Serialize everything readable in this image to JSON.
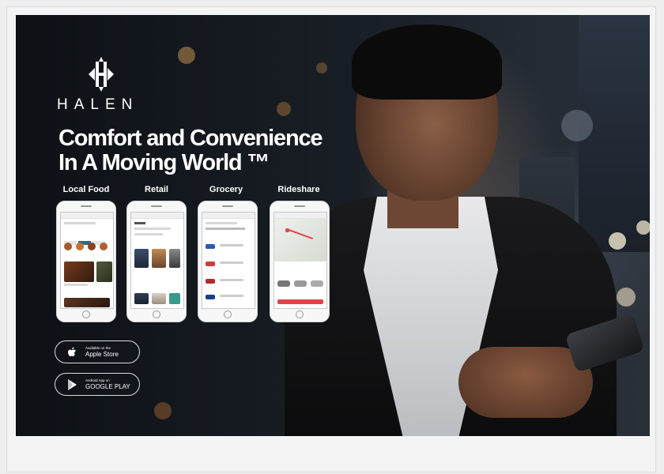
{
  "brand": {
    "name": "HALEN",
    "tagline_line1": "Comfort and Convenience",
    "tagline_line2": "In A Moving World ™"
  },
  "categories": [
    {
      "label": "Local Food"
    },
    {
      "label": "Retail"
    },
    {
      "label": "Grocery"
    },
    {
      "label": "Rideshare"
    }
  ],
  "stores": {
    "apple": {
      "small": "Available on the",
      "big": "Apple Store",
      "icon": "apple-icon"
    },
    "google": {
      "small": "Android App on",
      "big": "GOOGLE PLAY",
      "icon": "play-icon"
    }
  },
  "colors": {
    "accent": "#e2444b",
    "teal": "#2f6a86",
    "white": "#ffffff"
  }
}
